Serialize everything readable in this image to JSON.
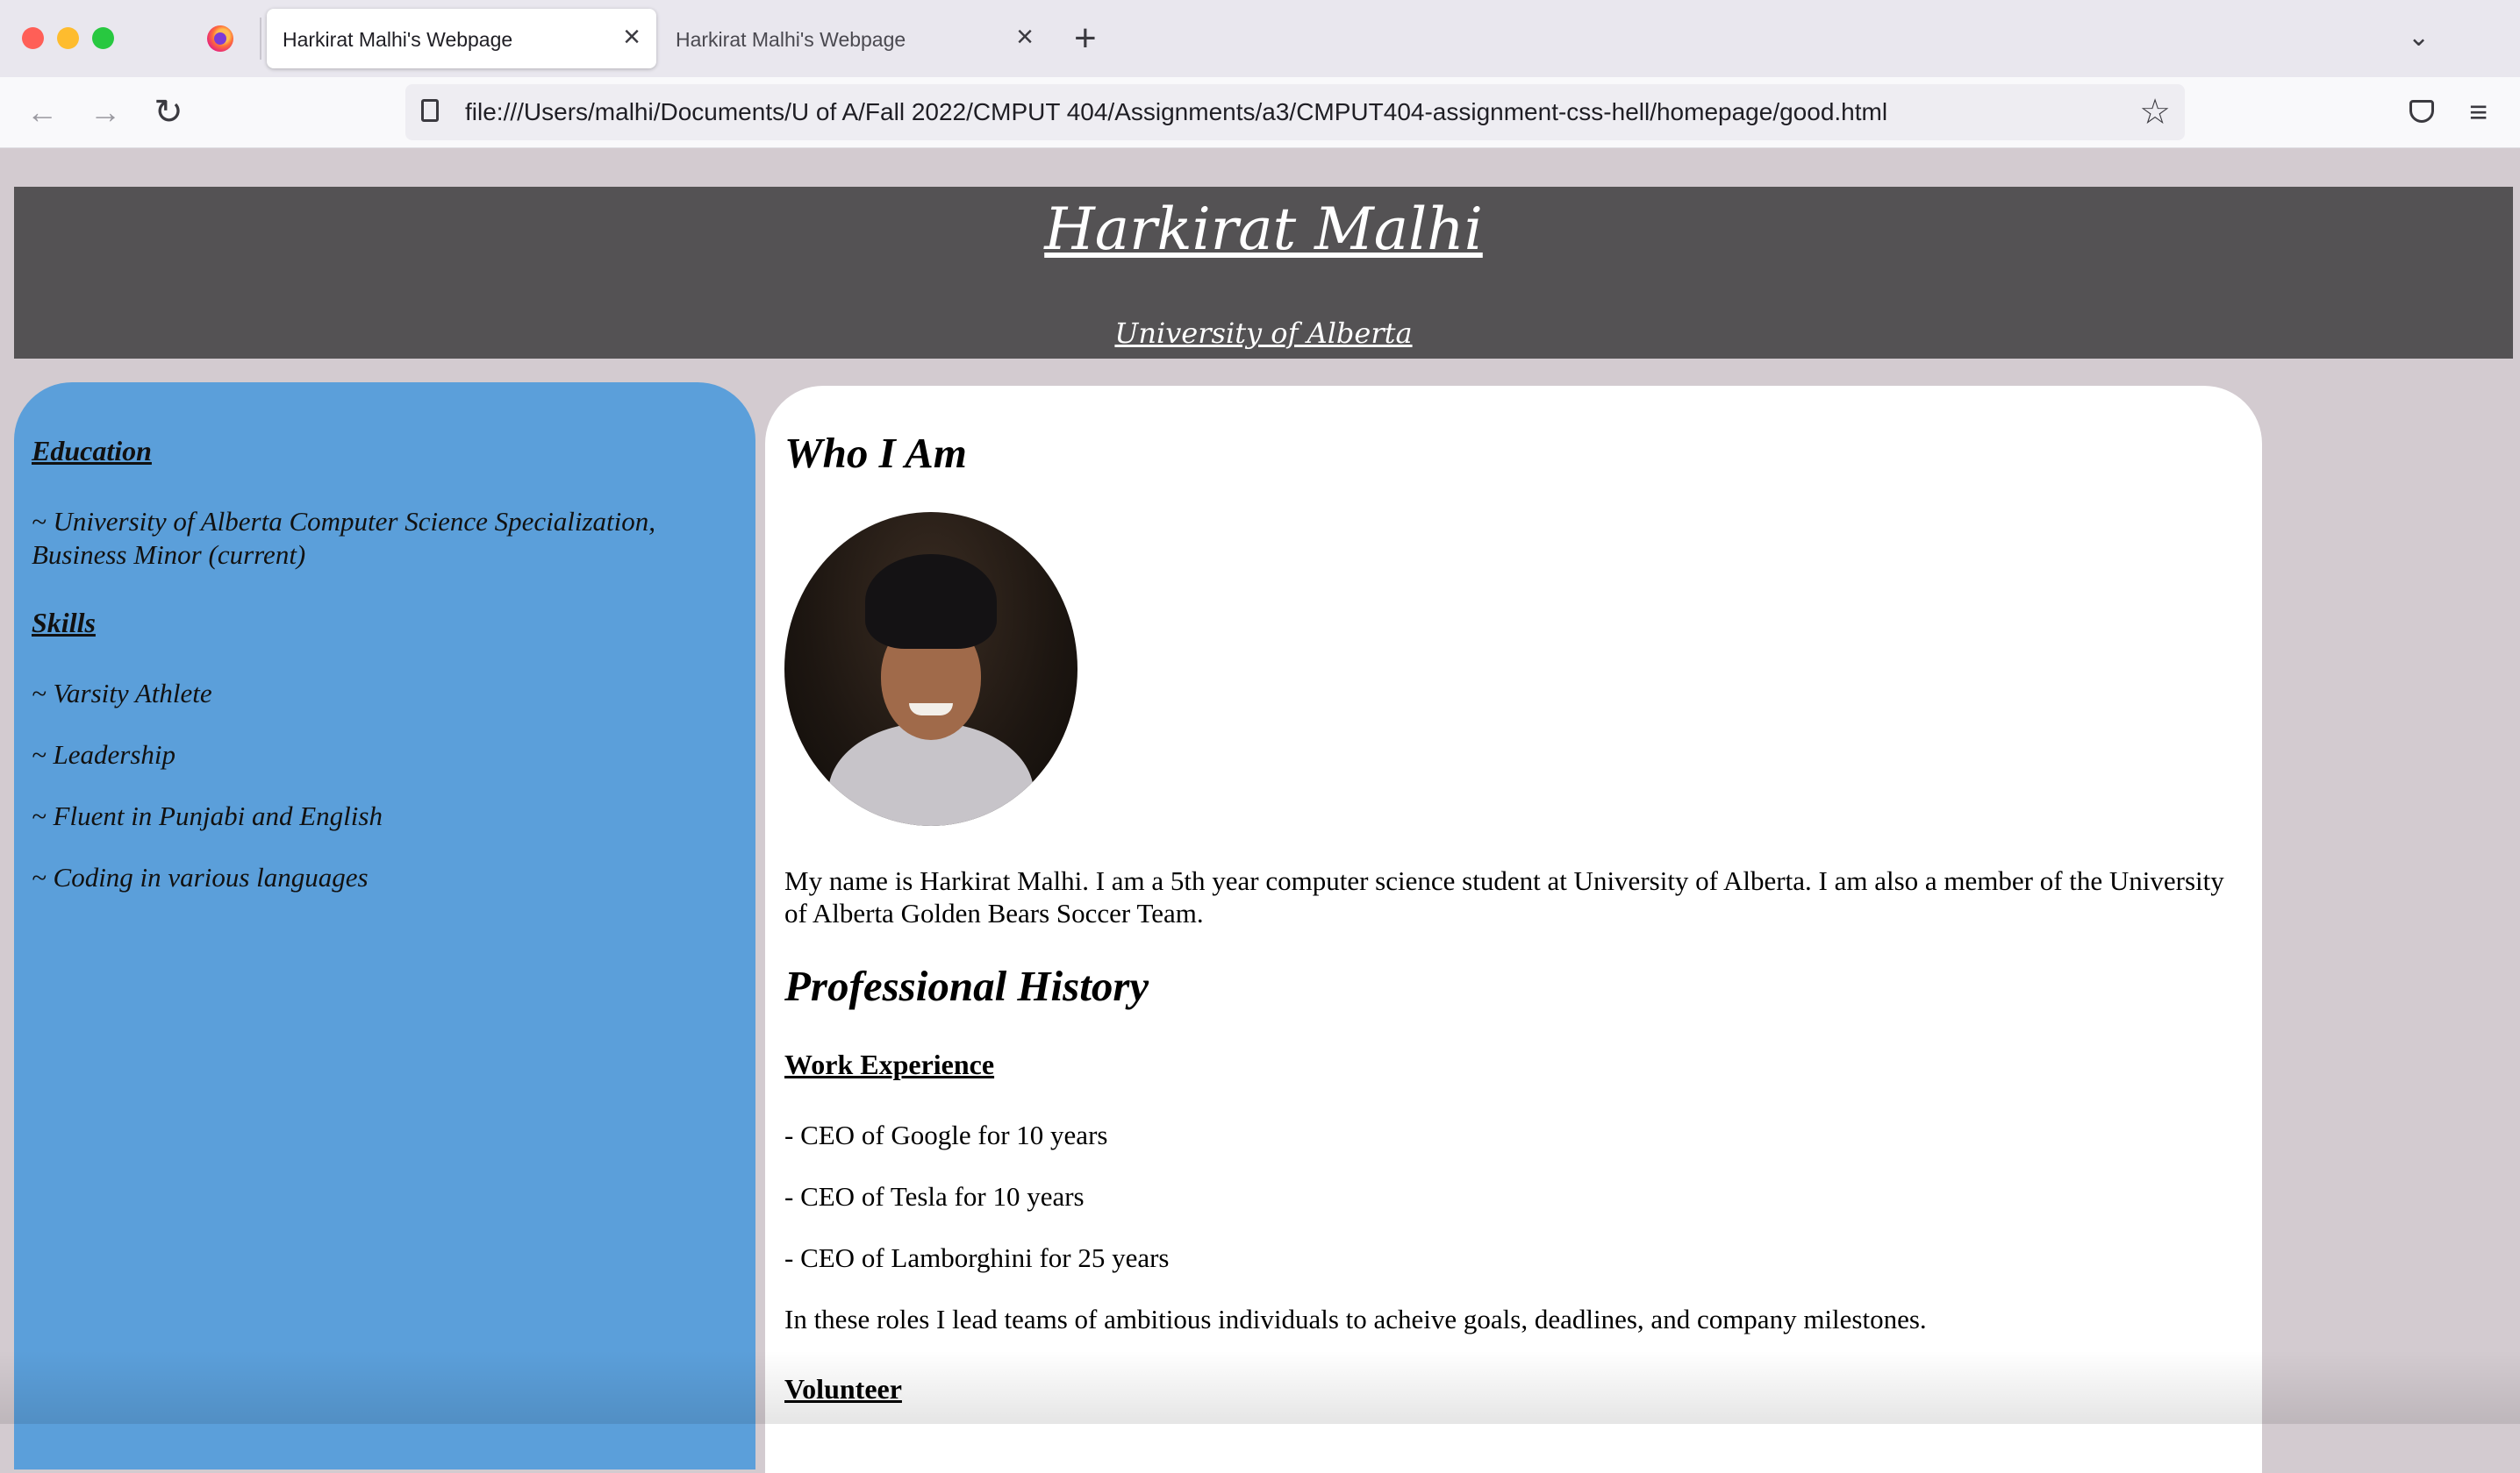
{
  "browser": {
    "tabs": [
      {
        "title": "Harkirat Malhi's Webpage",
        "active": true
      },
      {
        "title": "Harkirat Malhi's Webpage",
        "active": false
      }
    ],
    "close_glyph": "×",
    "new_tab_glyph": "+",
    "tab_list_glyph": "⌄",
    "url": "file:///Users/malhi/Documents/U of A/Fall 2022/CMPUT 404/Assignments/a3/CMPUT404-assignment-css-hell/homepage/good.html",
    "back_glyph": "←",
    "forward_glyph": "→",
    "reload_glyph": "↻",
    "star_glyph": "☆",
    "menu_glyph": "≡"
  },
  "header": {
    "name": "Harkirat Malhi",
    "school": "University of Alberta",
    "background_color": "#545254"
  },
  "sidebar": {
    "education_title": "Education",
    "education_item": "~ University of Alberta Computer Science Specialization, Business Minor (current)",
    "skills_title": "Skills",
    "skills": [
      "~ Varsity Athlete",
      "~ Leadership",
      "~ Fluent in Punjabi and English",
      "~ Coding in various languages"
    ],
    "background_color": "#5b9fda"
  },
  "main": {
    "who_title": "Who I Am",
    "bio": "My name is Harkirat Malhi. I am a 5th year computer science student at University of Alberta. I am also a member of the University of Alberta Golden Bears Soccer Team.",
    "history_title": "Professional History",
    "work_title": "Work Experience",
    "work_items": [
      "- CEO of Google for 10 years",
      "- CEO of Tesla for 10 years",
      "- CEO of Lamborghini for 25 years"
    ],
    "roles_text": "In these roles I lead teams of ambitious individuals to acheive goals, deadlines, and company milestones.",
    "volunteer_title": "Volunteer"
  }
}
